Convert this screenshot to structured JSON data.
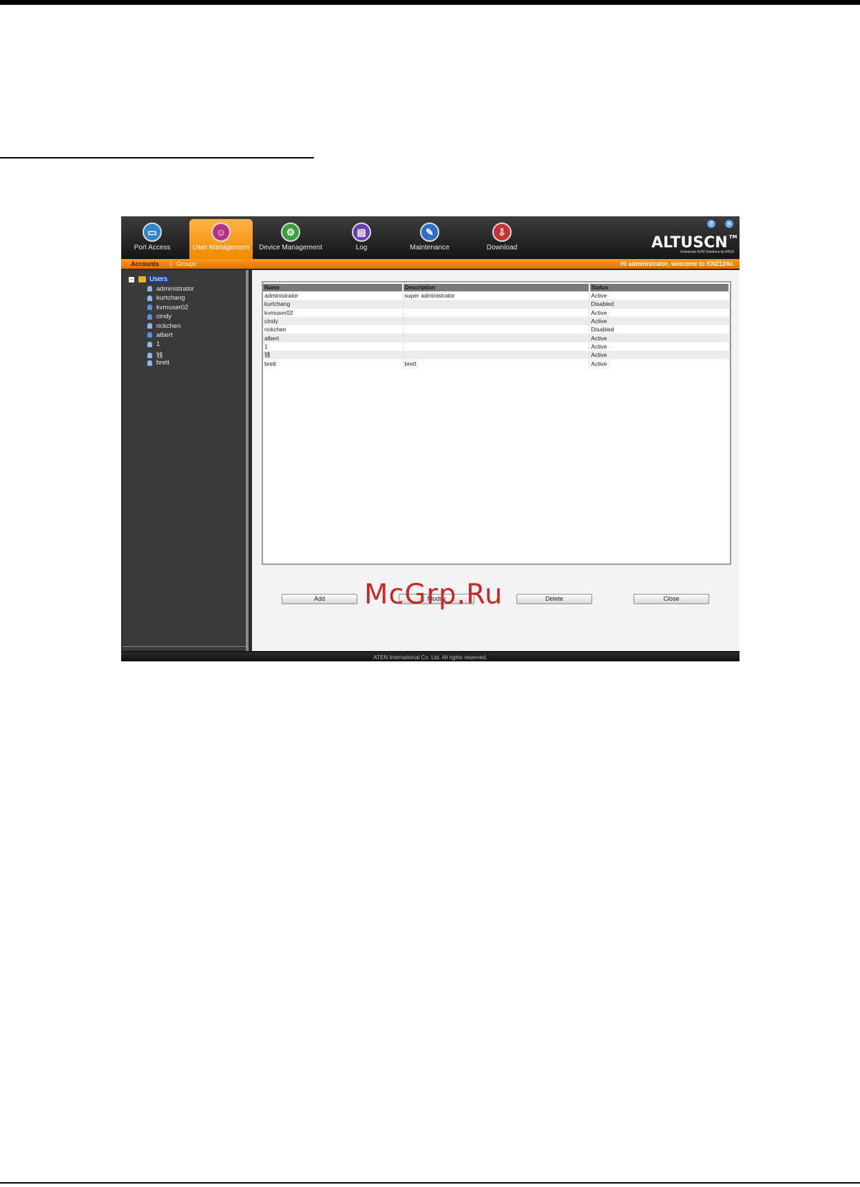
{
  "watermark": "McGrp.Ru",
  "window": {
    "tabs": [
      {
        "label": "Port Access",
        "icon": "monitor-icon",
        "color": "#2f86c8"
      },
      {
        "label": "User Management",
        "icon": "users-icon",
        "color": "#b83280"
      },
      {
        "label": "Device Management",
        "icon": "gear-icon",
        "color": "#3aa03a"
      },
      {
        "label": "Log",
        "icon": "log-icon",
        "color": "#6a3fb8"
      },
      {
        "label": "Maintenance",
        "icon": "wrench-icon",
        "color": "#2f6fc8"
      },
      {
        "label": "Download",
        "icon": "download-icon",
        "color": "#c83232"
      }
    ],
    "brand": {
      "logo": "ALTUSCN",
      "tm": "TM",
      "tagline": "Enterprise KVM Solutions by ATEN"
    },
    "subtabs": {
      "accounts": "Accounts",
      "separator": "|",
      "groups": "Groups"
    },
    "welcome": "Hi administrator, welcome to KN2124v.",
    "footer": "ATEN International Co. Ltd. All rights reserved."
  },
  "sidebar": {
    "root_label": "Users",
    "toggle": "−",
    "users": [
      "administrator",
      "kurtchang",
      "kvmuser02",
      "cindy",
      "rickchen",
      "albert",
      "1",
      "钱",
      "brett"
    ]
  },
  "table": {
    "headers": [
      "Name",
      "Description",
      "Status"
    ],
    "rows": [
      [
        "administrator",
        "super administrator",
        "Active"
      ],
      [
        "kurtchang",
        "",
        "Disabled"
      ],
      [
        "kvmuser02",
        "",
        "Active"
      ],
      [
        "cindy",
        "",
        "Active"
      ],
      [
        "rickchen",
        "",
        "Disabled"
      ],
      [
        "albert",
        "",
        "Active"
      ],
      [
        "1",
        "",
        "Active"
      ],
      [
        "钱",
        "",
        "Active"
      ],
      [
        "brett",
        "brett",
        "Active"
      ]
    ]
  },
  "buttons": {
    "add": "Add",
    "modify": "Modify",
    "delete": "Delete",
    "close": "Close"
  }
}
